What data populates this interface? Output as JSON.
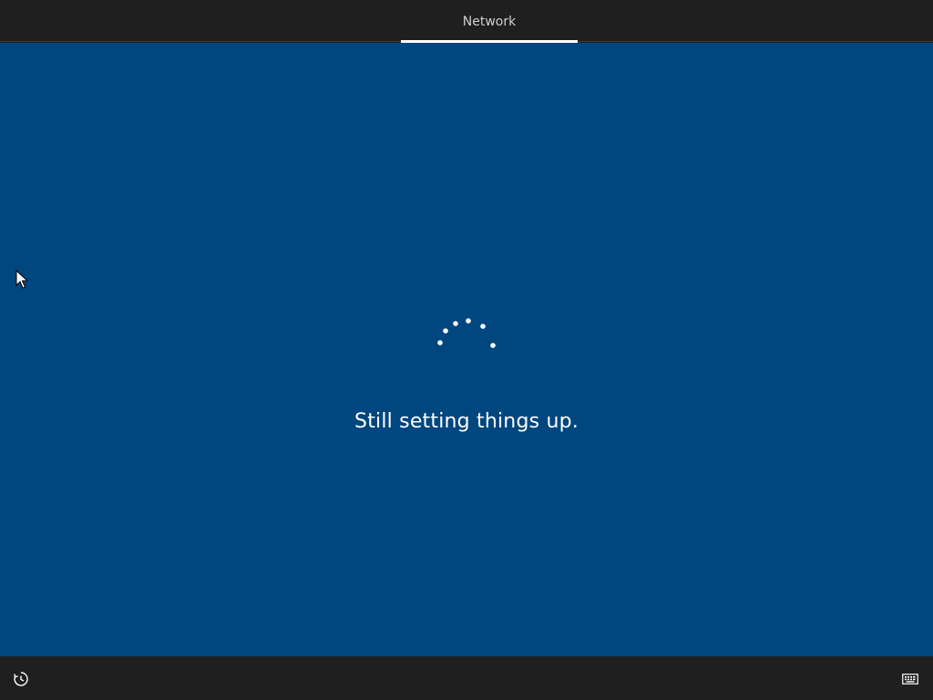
{
  "header": {
    "tabs": [
      {
        "label": "Network",
        "active": true
      }
    ]
  },
  "main": {
    "status_text": "Still setting things up.",
    "background_color": "#00467f",
    "spinner_icon": "loading-dots-icon"
  },
  "footer": {
    "left_icon": "ease-of-access-icon",
    "right_icon": "keyboard-icon"
  }
}
